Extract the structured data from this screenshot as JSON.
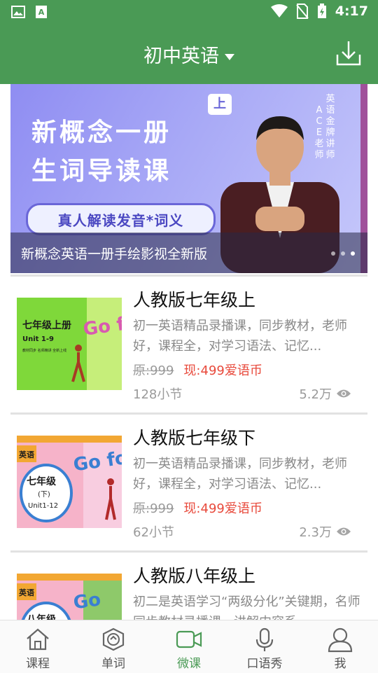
{
  "status_bar": {
    "time": "4:17"
  },
  "app_bar": {
    "title": "初中英语"
  },
  "banner": {
    "line1": "新概念一册",
    "line2": "生词导读课",
    "badge": "上",
    "pill": "真人解读发音*词义",
    "vertical_text_1": "英语金牌讲师",
    "vertical_text_2": "ACE老师",
    "caption": "新概念英语一册手绘影视全新版",
    "active_dot": 3
  },
  "courses": [
    {
      "title": "人教版七年级上",
      "description": "初一英语精品录播课，同步教材，老师好，课程全，对学习语法、记忆...",
      "original_price": "原:999",
      "current_price": "现:499爱语币",
      "lessons": "128小节",
      "views": "5.2万",
      "thumb_title": "七年级上册",
      "thumb_sub": "Unit 1-9",
      "thumb_note": "教材同步 名师精讲 全新上线",
      "thumb_go": "Go for it!"
    },
    {
      "title": "人教版七年级下",
      "description": "初一英语精品录播课，同步教材，老师好，课程全，对学习语法、记忆...",
      "original_price": "原:999",
      "current_price": "现:499爱语币",
      "lessons": "62小节",
      "views": "2.3万",
      "thumb_tag": "英语",
      "thumb_title": "七年级",
      "thumb_sub": "(下)",
      "thumb_units": "Unit1-12",
      "thumb_go": "Go for it!"
    },
    {
      "title": "人教版八年级上",
      "description": "初二是英语学习“两级分化”关键期，名师同步教材录播课，讲解内容系...",
      "thumb_tag": "英语",
      "thumb_title": "八年级",
      "thumb_go": "Go"
    }
  ],
  "bottom_nav": [
    {
      "label": "课程",
      "icon": "home-icon"
    },
    {
      "label": "单词",
      "icon": "word-badge-icon"
    },
    {
      "label": "微课",
      "icon": "video-camera-icon",
      "active": true
    },
    {
      "label": "口语秀",
      "icon": "microphone-icon"
    },
    {
      "label": "我",
      "icon": "user-icon"
    }
  ],
  "colors": {
    "primary": "#4a9a55",
    "price_red": "#e84a3c",
    "banner_purple": "#8f8df2"
  }
}
